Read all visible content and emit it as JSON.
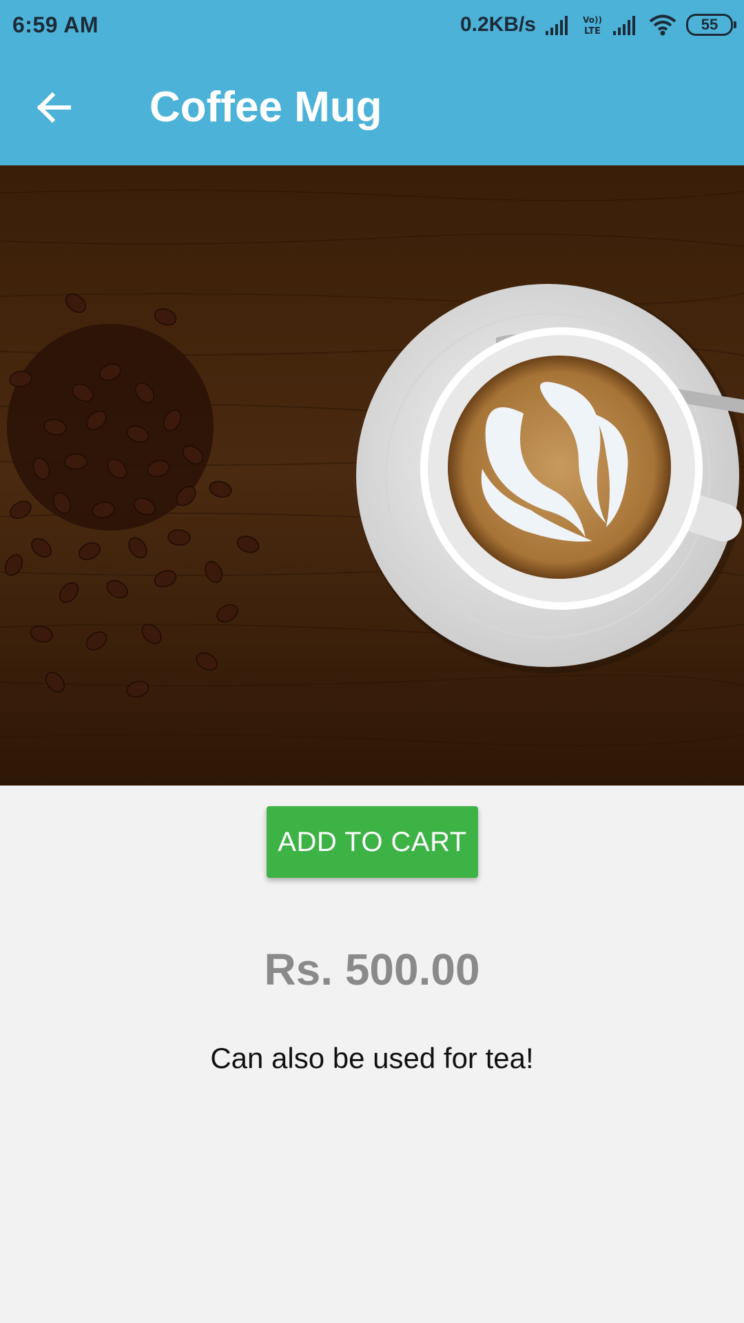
{
  "status_bar": {
    "time": "6:59 AM",
    "net_speed": "0.2KB/s",
    "lte_top": "Vo))",
    "lte_bottom": "LTE",
    "battery": "55",
    "icons": [
      "signal-icon",
      "lte-icon",
      "signal-icon",
      "wifi-icon",
      "battery-icon"
    ]
  },
  "app_bar": {
    "title": "Coffee Mug",
    "back_icon": "arrow-left-icon",
    "color": "#4db2d8"
  },
  "product": {
    "image_subject": "coffee-cup-with-latte-art-and-beans",
    "add_to_cart_label": "ADD TO CART",
    "add_to_cart_color": "#3db346",
    "price": "Rs. 500.00",
    "description": "Can also be used for tea!"
  }
}
